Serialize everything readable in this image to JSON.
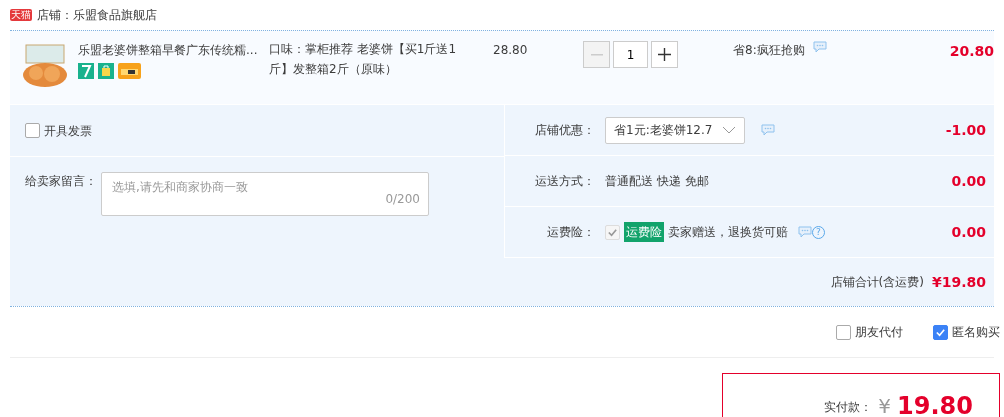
{
  "store": {
    "badge": "天猫",
    "label": "店铺：乐盟食品旗舰店"
  },
  "item": {
    "title": "乐盟老婆饼整箱早餐广东传统糯...",
    "spec": "口味：掌柜推荐 老婆饼【买1斤送1斤】发整箱2斤（原味）",
    "unit_price": "28.80",
    "quantity": "1",
    "promo": "省8:疯狂抢购",
    "subtotal": "20.80"
  },
  "invoice": {
    "label": "开具发票",
    "checked": false
  },
  "message": {
    "label": "给卖家留言：",
    "placeholder": "选填,请先和商家协商一致",
    "counter": "0/200"
  },
  "options": [
    {
      "kind": "select",
      "label": "店铺优惠：",
      "value": "省1元:老婆饼12.7",
      "amount": "-1.00"
    },
    {
      "kind": "text",
      "label": "运送方式：",
      "value": "普通配送 快递 免邮",
      "amount": "0.00"
    },
    {
      "kind": "insurance",
      "label": "运费险：",
      "checked": true,
      "disabled": true,
      "tag": "运费险",
      "value": "卖家赠送，退换货可赔",
      "help": "?",
      "amount": "0.00"
    }
  ],
  "total": {
    "label": "店铺合计(含运费)",
    "amount": "¥19.80"
  },
  "extras": [
    {
      "label": "朋友代付",
      "checked": false
    },
    {
      "label": "匿名购买",
      "checked": true
    }
  ],
  "payment": {
    "label": "实付款：",
    "currency": "¥",
    "amount": "19.80"
  }
}
